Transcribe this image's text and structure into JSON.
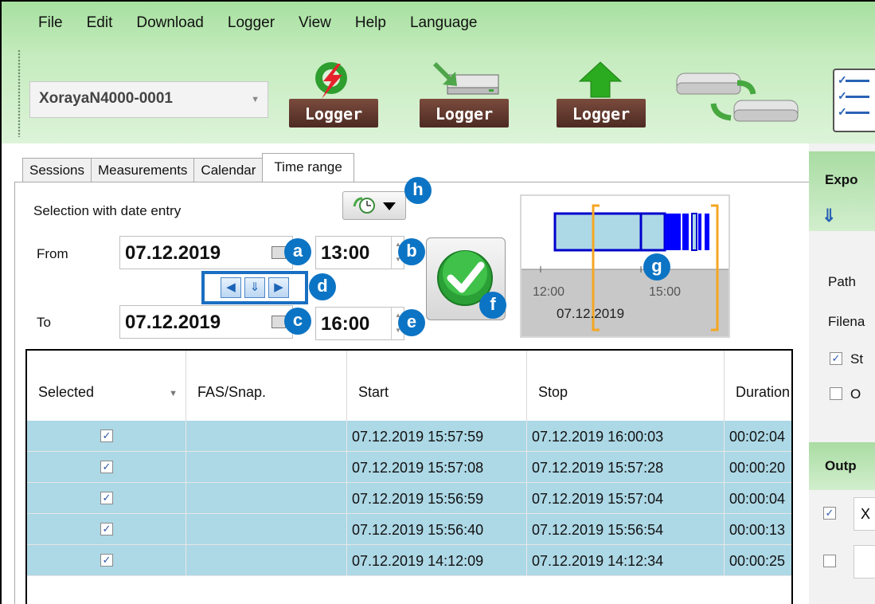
{
  "menu": [
    "File",
    "Edit",
    "Download",
    "Logger",
    "View",
    "Help",
    "Language"
  ],
  "device": {
    "selected": "XorayaN4000-0001"
  },
  "toolbar": {
    "logger_labels": [
      "Logger",
      "Logger",
      "Logger"
    ]
  },
  "tabs": [
    "Sessions",
    "Measurements",
    "Calendar",
    "Time range"
  ],
  "selection_title": "Selection with date entry",
  "from": {
    "label": "From",
    "date": "07.12.2019",
    "time": "13:00"
  },
  "to": {
    "label": "To",
    "date": "07.12.2019",
    "time": "16:00"
  },
  "badges": {
    "a": "a",
    "b": "b",
    "c": "c",
    "d": "d",
    "e": "e",
    "f": "f",
    "g": "g",
    "h": "h"
  },
  "timeline": {
    "tick1": "12:00",
    "tick2": "15:00",
    "date": "07.12.2019"
  },
  "grid": {
    "columns": [
      "Selected",
      "FAS/Snap.",
      "Start",
      "Stop",
      "Duration"
    ],
    "rows": [
      {
        "selected": true,
        "fas": "",
        "start": "07.12.2019 15:57:59",
        "stop": "07.12.2019 16:00:03",
        "duration": "00:02:04"
      },
      {
        "selected": true,
        "fas": "",
        "start": "07.12.2019 15:57:08",
        "stop": "07.12.2019 15:57:28",
        "duration": "00:00:20"
      },
      {
        "selected": true,
        "fas": "",
        "start": "07.12.2019 15:56:59",
        "stop": "07.12.2019 15:57:04",
        "duration": "00:00:04"
      },
      {
        "selected": true,
        "fas": "",
        "start": "07.12.2019 15:56:40",
        "stop": "07.12.2019 15:56:54",
        "duration": "00:00:13"
      },
      {
        "selected": true,
        "fas": "",
        "start": "07.12.2019 14:12:09",
        "stop": "07.12.2019 14:12:34",
        "duration": "00:00:25"
      }
    ]
  },
  "right": {
    "export": "Expo",
    "path": "Path",
    "filename": "Filena",
    "opt1": "St",
    "opt2": "O",
    "output": "Outp",
    "out1": "X"
  }
}
